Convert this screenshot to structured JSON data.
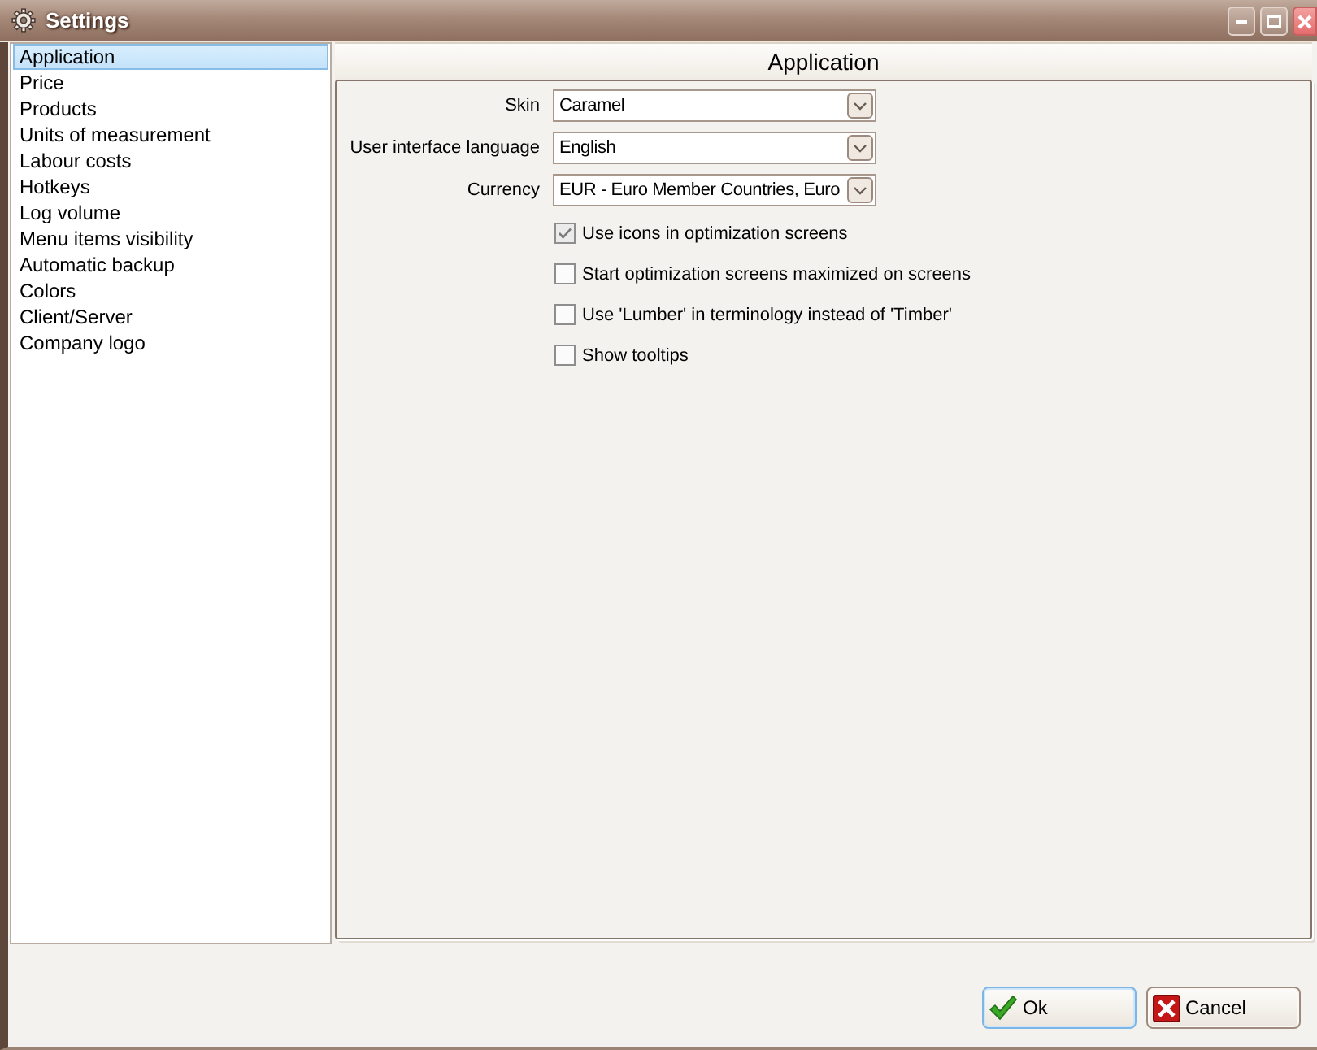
{
  "window": {
    "title": "Settings"
  },
  "sidebar": {
    "items": [
      {
        "label": "Application",
        "selected": true
      },
      {
        "label": "Price",
        "selected": false
      },
      {
        "label": "Products",
        "selected": false
      },
      {
        "label": "Units of measurement",
        "selected": false
      },
      {
        "label": "Labour costs",
        "selected": false
      },
      {
        "label": "Hotkeys",
        "selected": false
      },
      {
        "label": "Log volume",
        "selected": false
      },
      {
        "label": "Menu items visibility",
        "selected": false
      },
      {
        "label": "Automatic backup",
        "selected": false
      },
      {
        "label": "Colors",
        "selected": false
      },
      {
        "label": "Client/Server",
        "selected": false
      },
      {
        "label": "Company logo",
        "selected": false
      }
    ]
  },
  "panel": {
    "title": "Application",
    "fields": [
      {
        "label": "Skin",
        "value": "Caramel"
      },
      {
        "label": "User interface language",
        "value": "English"
      },
      {
        "label": "Currency",
        "value": "EUR - Euro Member Countries, Euro"
      }
    ],
    "options": [
      {
        "label": "Use icons in optimization screens",
        "checked": true
      },
      {
        "label": "Start optimization screens maximized on screens",
        "checked": false
      },
      {
        "label": "Use 'Lumber' in terminology instead of 'Timber'",
        "checked": false
      },
      {
        "label": "Show tooltips",
        "checked": false
      }
    ]
  },
  "buttons": [
    {
      "kind": "ok",
      "label": "Ok",
      "focused": true
    },
    {
      "kind": "cancel",
      "label": "Cancel",
      "focused": false
    }
  ]
}
